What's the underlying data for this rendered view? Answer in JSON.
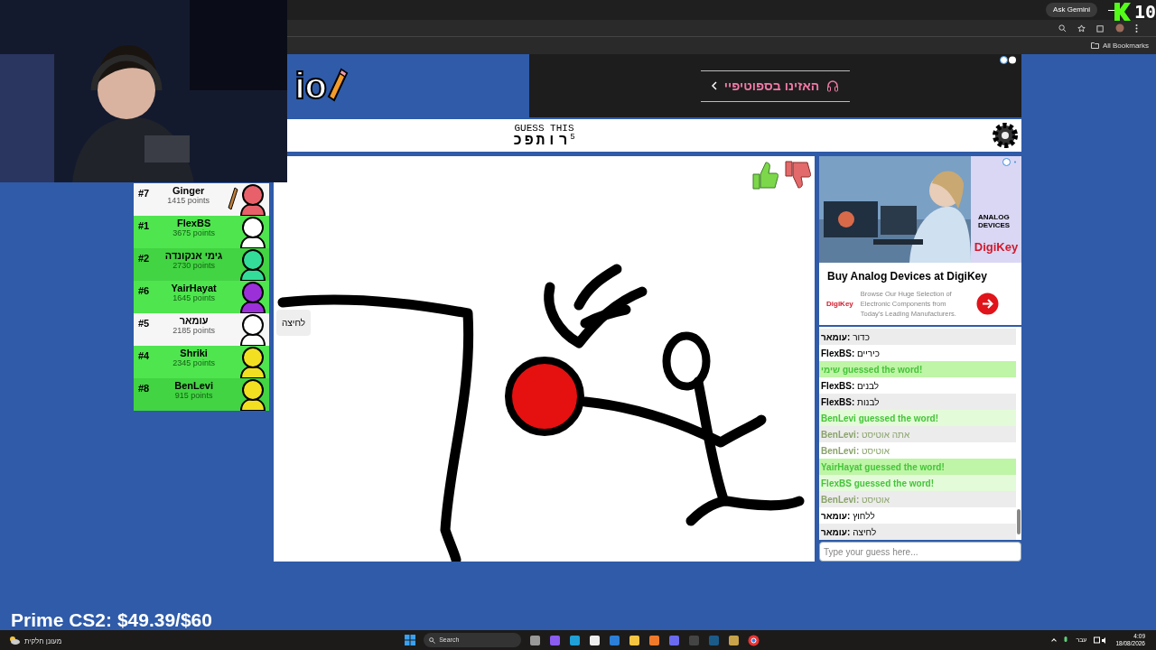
{
  "browser": {
    "gemini": "Ask Gemini",
    "bookmarks": "All Bookmarks",
    "corner_logo": "10"
  },
  "game": {
    "logo": "io",
    "ad_banner": "האזינו בספוטיפיי",
    "header": {
      "label": "GUESS THIS",
      "word": "רותפכ",
      "count": "5"
    }
  },
  "players": [
    {
      "rank": "#7",
      "name": "Ginger",
      "points": "1415 points",
      "guessed": false,
      "drawing": true,
      "color": "#e8616a"
    },
    {
      "rank": "#1",
      "name": "FlexBS",
      "points": "3675 points",
      "guessed": true,
      "drawing": false,
      "color": "#ffffff"
    },
    {
      "rank": "#2",
      "name": "גימי אנקונדה",
      "points": "2730 points",
      "guessed": true,
      "drawing": false,
      "color": "#33dd99"
    },
    {
      "rank": "#6",
      "name": "YairHayat",
      "points": "1645 points",
      "guessed": true,
      "drawing": false,
      "color": "#9b30d9"
    },
    {
      "rank": "#5",
      "name": "עומאר",
      "points": "2185 points",
      "guessed": false,
      "drawing": false,
      "color": "#ffffff",
      "bubble": "לחיצה"
    },
    {
      "rank": "#4",
      "name": "Shriki",
      "points": "2345 points",
      "guessed": true,
      "drawing": false,
      "color": "#f2df22"
    },
    {
      "rank": "#8",
      "name": "BenLevi",
      "points": "915 points",
      "guessed": true,
      "drawing": false,
      "color": "#f2df22"
    }
  ],
  "side_ad": {
    "brand_top": "ANALOG DEVICES",
    "brand_panel": "DigiKey",
    "title": "Buy Analog Devices at DigiKey",
    "brand_small": "DigiKey",
    "body": "Browse Our Huge Selection of Electronic Components from Today's Leading Manufacturers."
  },
  "chat": [
    {
      "kind": "chat",
      "name": "עומאר:",
      "text": "כדור"
    },
    {
      "kind": "chat",
      "name": "FlexBS:",
      "text": "כיריים"
    },
    {
      "kind": "guessed",
      "text": "שימי guessed the word!"
    },
    {
      "kind": "chat",
      "name": "FlexBS:",
      "text": "לבנים"
    },
    {
      "kind": "chat",
      "name": "FlexBS:",
      "text": "לבנות"
    },
    {
      "kind": "guessed",
      "text": "BenLevi guessed the word!"
    },
    {
      "kind": "faded",
      "name": "BenLevi:",
      "text": "אתה אוטיסט"
    },
    {
      "kind": "faded",
      "name": "BenLevi:",
      "text": "אוטיסט"
    },
    {
      "kind": "guessed",
      "text": "YairHayat guessed the word!"
    },
    {
      "kind": "guessed",
      "text": "FlexBS guessed the word!"
    },
    {
      "kind": "faded",
      "name": "BenLevi:",
      "text": "אוטיסט"
    },
    {
      "kind": "chat",
      "name": "עומאר:",
      "text": "ללחוץ"
    },
    {
      "kind": "chat",
      "name": "עומאר:",
      "text": "לחיצה"
    }
  ],
  "guess_input": {
    "placeholder": "Type your guess here..."
  },
  "overlay": {
    "text": "Prime CS2: $49.39/$60"
  },
  "taskbar": {
    "weather": "מעונן חלקית",
    "search": "Search",
    "language": "עבר",
    "time": "4:09",
    "date": "18/08/2026"
  }
}
